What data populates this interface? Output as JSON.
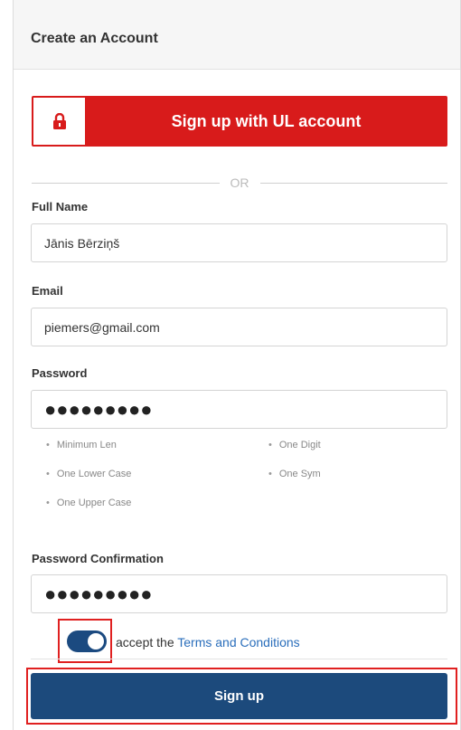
{
  "header": {
    "title": "Create an Account"
  },
  "ul_signup": {
    "label": "Sign up with UL account",
    "icon": "lock-icon"
  },
  "divider": {
    "or_text": "OR"
  },
  "fields": {
    "full_name": {
      "label": "Full Name",
      "value": "Jānis Bērziņš"
    },
    "email": {
      "label": "Email",
      "value": "piemers@gmail.com"
    },
    "password": {
      "label": "Password",
      "value": "●●●●●●●●●"
    },
    "password_confirmation": {
      "label": "Password Confirmation",
      "value": "●●●●●●●●●"
    }
  },
  "password_requirements": {
    "min_len": "Minimum Len",
    "one_digit": "One Digit",
    "one_lower": "One Lower Case",
    "one_sym": "One Sym",
    "one_upper": "One Upper Case"
  },
  "terms": {
    "toggle_on": true,
    "prefix": "accept the ",
    "link": "Terms and Conditions"
  },
  "submit": {
    "label": "Sign up"
  },
  "colors": {
    "ul_red": "#d81b1b",
    "primary_blue": "#1c4a7c",
    "link_blue": "#2a6ebb",
    "highlight_red": "#e02020"
  }
}
